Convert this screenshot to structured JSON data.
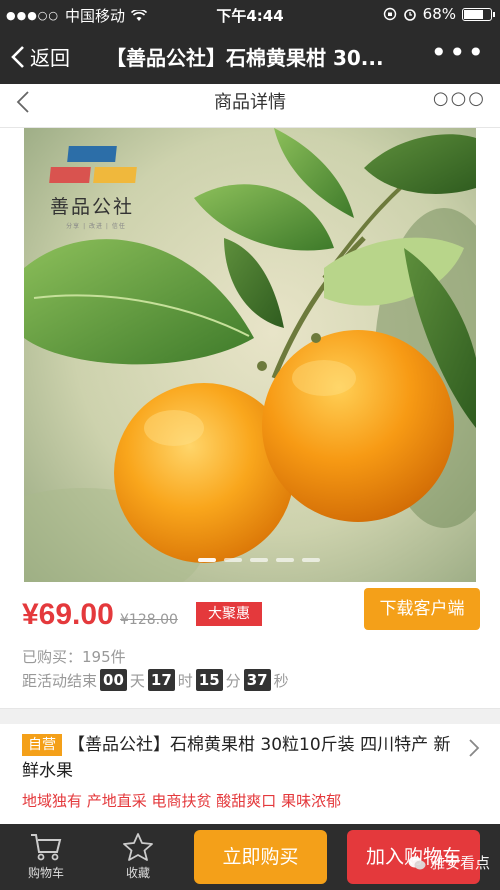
{
  "status": {
    "carrier": "中国移动",
    "time": "下午4:44",
    "battery": "68%",
    "battery_level": 0.68
  },
  "wechat": {
    "back_label": "返回",
    "title": "【善品公社】石棉黄果柑 30...",
    "more": "•••"
  },
  "header": {
    "title": "商品详情",
    "more": "○○○"
  },
  "hero": {
    "brand": "善品公社",
    "brand_tagline": "分享 | 改进 | 信任",
    "carousel_count": 5
  },
  "product": {
    "price": "¥69.00",
    "old_price": "¥128.00",
    "badge": "大聚惠",
    "download_label": "下载客户端",
    "sold": "已购买：195件",
    "countdown": {
      "prefix": "距活动结束",
      "days": "00",
      "days_unit": "天",
      "hours": "17",
      "hours_unit": "时",
      "minutes": "15",
      "minutes_unit": "分",
      "seconds": "37",
      "seconds_unit": "秒"
    },
    "self_tag": "自营",
    "title": "【善品公社】石棉黄果柑 30粒10斤装 四川特产 新鲜水果",
    "features": "地域独有 产地直采 电商扶贫 酸甜爽口 果味浓郁"
  },
  "bottom": {
    "cart_label": "购物车",
    "favorite_label": "收藏",
    "buy_now": "立即购买",
    "add_to_cart": "加入购物车",
    "watermark": "雅安看点"
  },
  "colors": {
    "accent_red": "#e4393c",
    "accent_orange": "#f4a019",
    "dark_bar": "#2b2b2b"
  }
}
